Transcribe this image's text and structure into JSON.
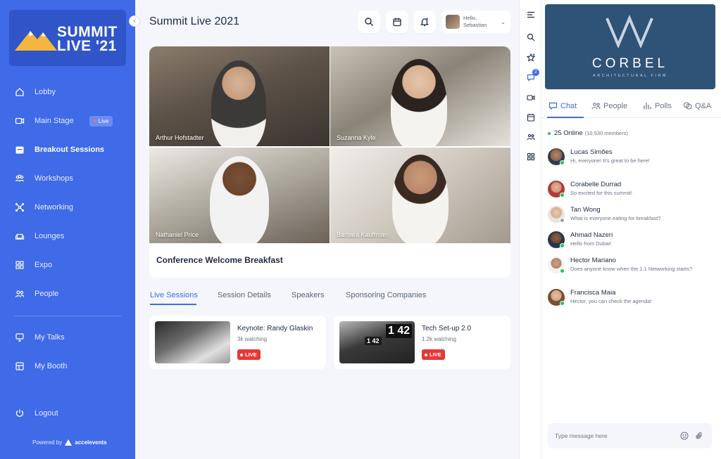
{
  "app": {
    "logo_line1": "SUMMIT",
    "logo_line2": "LIVE '21",
    "collapse_glyph": "‹",
    "page_title": "Summit Live 2021",
    "accent_color": "#3f6ae8"
  },
  "sidebar": {
    "items": [
      {
        "label": "Lobby",
        "icon": "home-icon"
      },
      {
        "label": "Main Stage",
        "icon": "video-icon",
        "badge": "Live"
      },
      {
        "label": "Breakout Sessions",
        "icon": "calendar-icon",
        "active": true
      },
      {
        "label": "Workshops",
        "icon": "group-icon"
      },
      {
        "label": "Networking",
        "icon": "network-icon"
      },
      {
        "label": "Lounges",
        "icon": "sofa-icon"
      },
      {
        "label": "Expo",
        "icon": "grid-icon"
      },
      {
        "label": "People",
        "icon": "people-icon"
      },
      {
        "label": "My Talks",
        "icon": "presentation-icon"
      },
      {
        "label": "My Booth",
        "icon": "booth-icon"
      },
      {
        "label": "Logout",
        "icon": "power-icon"
      }
    ],
    "powered_by": "Powered by",
    "powered_brand": "accelevents"
  },
  "header": {
    "greeting": "Hello,",
    "user_name": "Sebastian",
    "caret": "⌄"
  },
  "stage": {
    "speakers": [
      "Arthur Hofstadter",
      "Suzanna Kyle",
      "Nathaniel Price",
      "Barbara Kauffman"
    ],
    "title": "Conference Welcome Breakfast"
  },
  "tabs": [
    "Live Sessions",
    "Session Details",
    "Speakers",
    "Sponsoring Companies"
  ],
  "sessions": [
    {
      "title": "Keynote: Randy Glaskin",
      "watching": "3k watching",
      "badge": "LIVE"
    },
    {
      "title": "Tech Set-up 2.0",
      "watching": "1.2k watching",
      "badge": "LIVE",
      "clock_a": "1 42",
      "clock_b": "1 42"
    }
  ],
  "rail": {
    "chat_badge": "2"
  },
  "sponsor": {
    "name": "CORBEL",
    "tagline": "ARCHITECTURAL FIRM"
  },
  "chat": {
    "tabs": [
      "Chat",
      "People",
      "Polls",
      "Q&A"
    ],
    "online": "25 Online",
    "members": "(10,530 members)",
    "messages": [
      {
        "name": "Lucas Simões",
        "text": "Hi, everyone! It's great to be here!"
      },
      {
        "name": "Corabelle Durrad",
        "text": "So excited for this summit!"
      },
      {
        "name": "Tan Wong",
        "text": "What is everyone eating for breakfast?"
      },
      {
        "name": "Ahmad Nazeri",
        "text": "Hello from Dubai!"
      },
      {
        "name": "Hector Mariano",
        "text": "Does anyone know when the 1:1 Networking starts?"
      },
      {
        "name": "Francisca Maia",
        "text": "Hector, you can check the agenda!"
      }
    ],
    "input_placeholder": "Type message here"
  }
}
